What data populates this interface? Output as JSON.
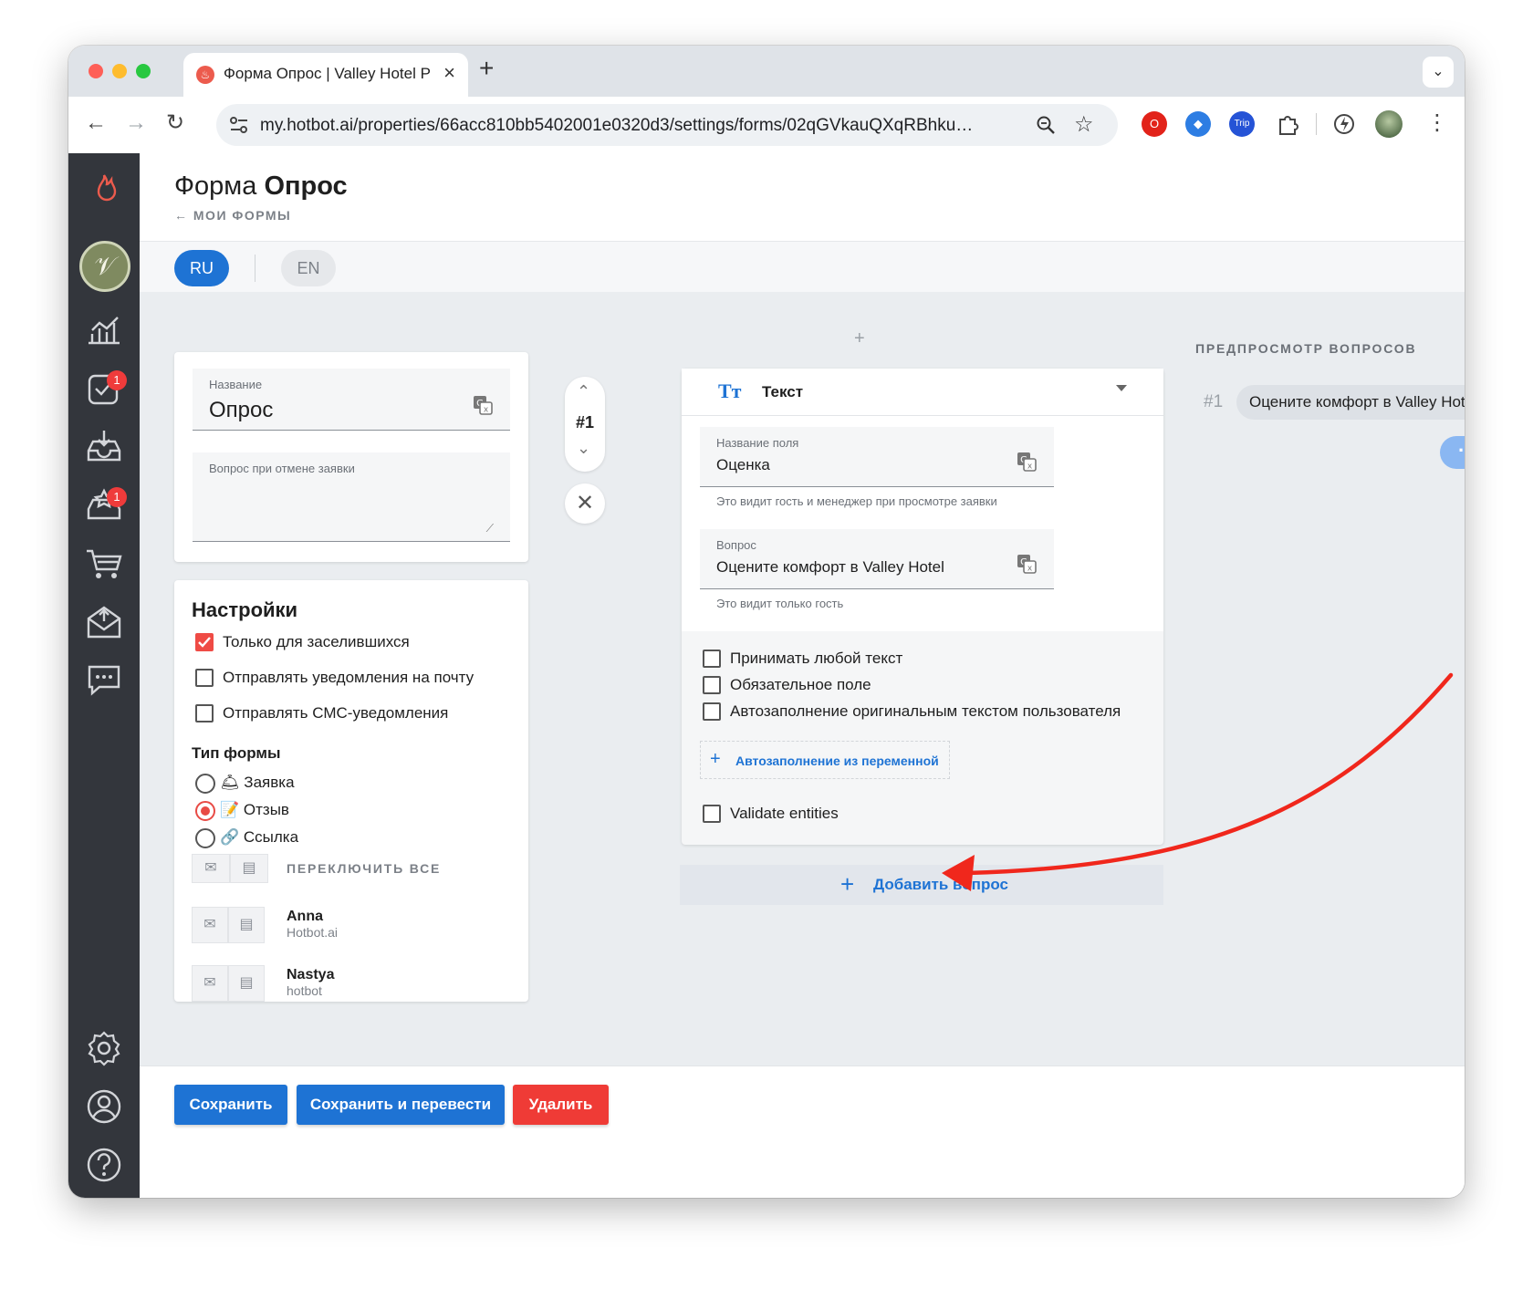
{
  "browser": {
    "tab_title": "Форма Опрос | Valley Hotel Р",
    "url": "my.hotbot.ai/properties/66acc810bb5402001e0320d3/settings/forms/02qGVkauQXqRBhku…",
    "ext_trip": "Trip"
  },
  "sidebar": {
    "badge_tasks": "1",
    "badge_reviews": "1"
  },
  "header": {
    "title_prefix": "Форма",
    "title_name": "Опрос",
    "back_link": "← МОИ ФОРМЫ"
  },
  "langs": {
    "ru": "RU",
    "en": "EN"
  },
  "form_card": {
    "name_label": "Название",
    "name_value": "Опрос",
    "cancel_label": "Вопрос при отмене заявки"
  },
  "settings": {
    "title": "Настройки",
    "opt_checked_in": "Только для заселившихся",
    "opt_email": "Отправлять уведомления на почту",
    "opt_sms": "Отправлять СМС-уведомления",
    "type_title": "Тип формы",
    "type_request": "🛎 Заявка",
    "type_review": "📝 Отзыв",
    "type_link": "🔗 Ссылка",
    "toggle_all": "ПЕРЕКЛЮЧИТЬ ВСЕ",
    "users": [
      {
        "name": "Anna",
        "org": "Hotbot.ai"
      },
      {
        "name": "Nastya",
        "org": "hotbot"
      }
    ]
  },
  "question": {
    "number": "#1",
    "type_label": "Текст",
    "field_name_label": "Название поля",
    "field_name_value": "Оценка",
    "field_name_hint": "Это видит гость и менеджер при просмотре заявки",
    "question_label": "Вопрос",
    "question_value": "Оцените комфорт в Valley Hotel",
    "question_hint": "Это видит только гость",
    "opt_any_text": "Принимать любой текст",
    "opt_required": "Обязательное поле",
    "opt_autofill_user": "Автозаполнение оригинальным текстом пользователя",
    "autofill_var": "Автозаполнение из переменной",
    "opt_validate": "Validate entities",
    "add_question": "Добавить вопрос"
  },
  "preview": {
    "title": "ПРЕДПРОСМОТР ВОПРОСОВ",
    "number": "#1",
    "bubble": "Оцените комфорт в Valley Hotel",
    "dots": "···"
  },
  "footer": {
    "save": "Сохранить",
    "save_translate": "Сохранить и перевести",
    "delete": "Удалить"
  },
  "colors": {
    "primary": "#1e73d4",
    "danger": "#ef3b36",
    "accent": "#ef4b45",
    "sidebar": "#33363c",
    "annotation": "#f0271c"
  }
}
